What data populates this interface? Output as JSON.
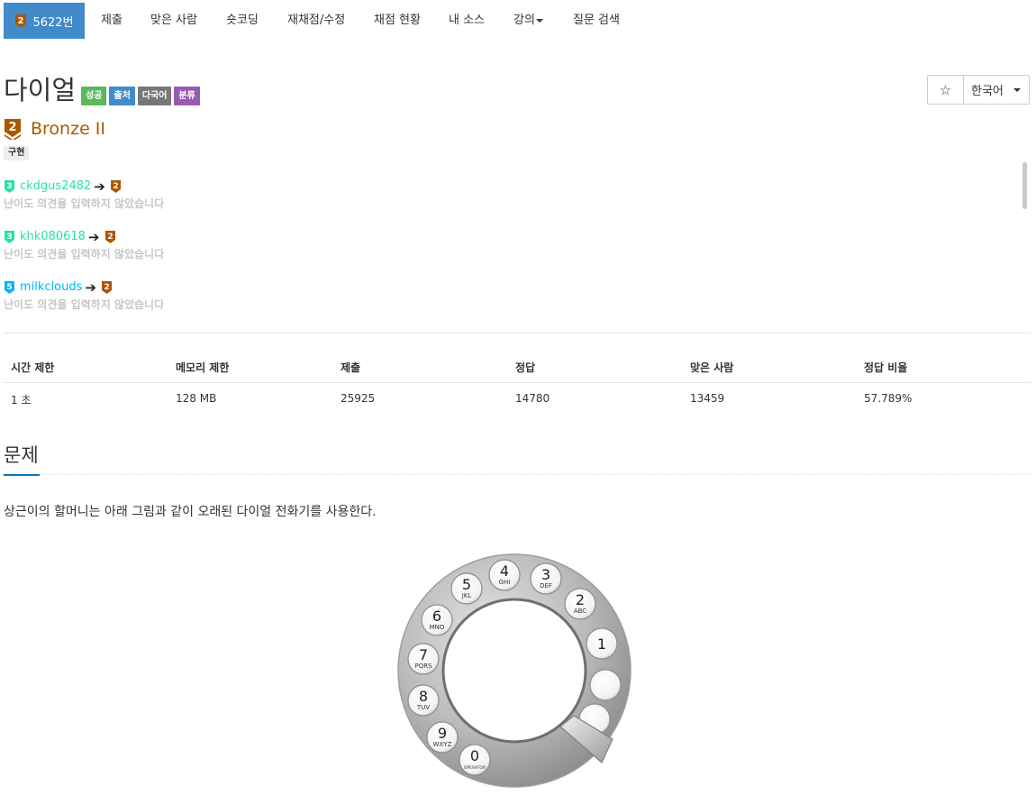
{
  "nav": {
    "active": {
      "tier_num": "2",
      "label": "5622번"
    },
    "items": [
      {
        "label": "제출"
      },
      {
        "label": "맞은 사람"
      },
      {
        "label": "숏코딩"
      },
      {
        "label": "재채점/수정"
      },
      {
        "label": "채점 현황"
      },
      {
        "label": "내 소스"
      },
      {
        "label": "강의"
      },
      {
        "label": "질문 검색"
      }
    ]
  },
  "problem": {
    "title": "다이얼",
    "labels": [
      {
        "text": "성공",
        "color": "#5cb85c"
      },
      {
        "text": "출처",
        "color": "#428bca"
      },
      {
        "text": "다국어",
        "color": "#777777"
      },
      {
        "text": "분류",
        "color": "#9b59b6"
      }
    ],
    "star": "☆",
    "language": "한국어"
  },
  "tier": {
    "num": "2",
    "name": "Bronze II",
    "tag": "구현"
  },
  "opinions": [
    {
      "from": "3",
      "from_color": "#27e2a4",
      "user": "ckdgus2482",
      "to": "2",
      "text": "난이도 의견을 입력하지 않았습니다"
    },
    {
      "from": "3",
      "from_color": "#27e2a4",
      "user": "khk080618",
      "to": "2",
      "text": "난이도 의견을 입력하지 않았습니다"
    },
    {
      "from": "5",
      "from_color": "#00b4fc",
      "user": "milkclouds",
      "to": "2",
      "text": "난이도 의견을 입력하지 않았습니다"
    }
  ],
  "stats": {
    "headers": [
      "시간 제한",
      "메모리 제한",
      "제출",
      "정답",
      "맞은 사람",
      "정답 비율"
    ],
    "values": [
      "1 초",
      "128 MB",
      "25925",
      "14780",
      "13459",
      "57.789%"
    ]
  },
  "section": {
    "title": "문제",
    "description": "상근이의 할머니는 아래 그림과 같이 오래된 다이얼 전화기를 사용한다."
  },
  "dial": {
    "holes": [
      {
        "num": "4",
        "sub": "GHI"
      },
      {
        "num": "3",
        "sub": "DEF"
      },
      {
        "num": "5",
        "sub": "JKL"
      },
      {
        "num": "2",
        "sub": "ABC"
      },
      {
        "num": "6",
        "sub": "MNO"
      },
      {
        "num": "1",
        "sub": ""
      },
      {
        "num": "7",
        "sub": "PQRS"
      },
      {
        "num": "",
        "sub": ""
      },
      {
        "num": "8",
        "sub": "TUV"
      },
      {
        "num": "",
        "sub": ""
      },
      {
        "num": "9",
        "sub": "WXYZ"
      },
      {
        "num": "0",
        "sub": "OPERATOR"
      }
    ]
  },
  "colors": {
    "bronze": "#ad5600",
    "nav_active": "#428bca",
    "section_accent": "#0076c0"
  }
}
